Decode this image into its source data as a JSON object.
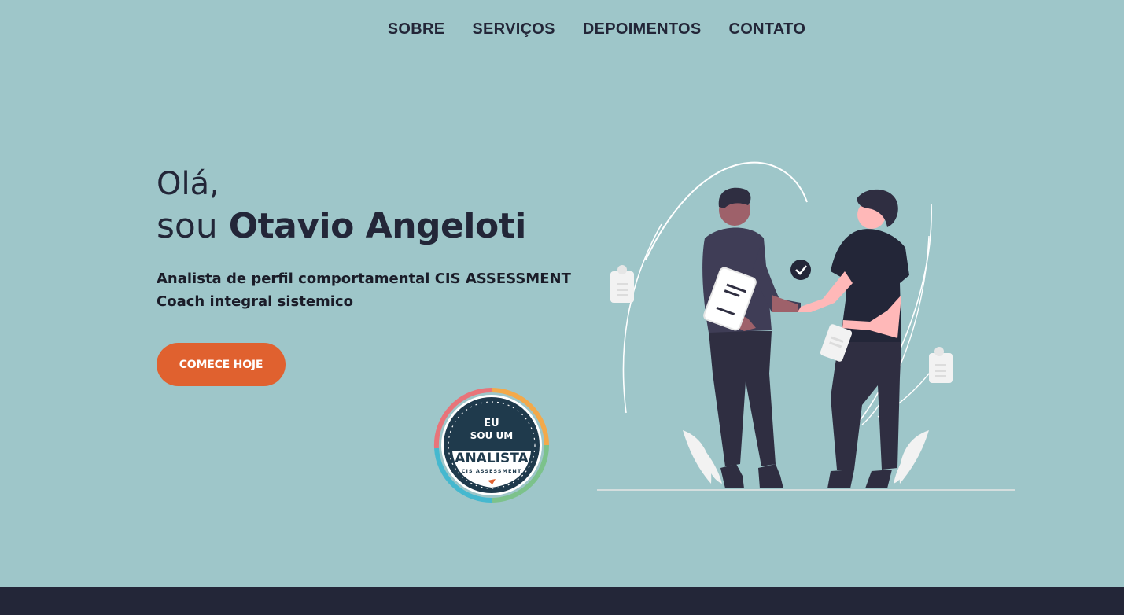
{
  "nav": {
    "items": [
      {
        "label": "SOBRE"
      },
      {
        "label": "SERVIÇOS"
      },
      {
        "label": "DEPOIMENTOS"
      },
      {
        "label": "CONTATO"
      }
    ]
  },
  "hero": {
    "greeting": "Olá,",
    "name_prefix": "sou",
    "name": "Otavio Angeloti",
    "tagline_line1": "Analista de perfil comportamental CIS ASSESSMENT",
    "tagline_line2": "Coach integral sistemico",
    "cta_label": "COMECE HOJE"
  },
  "badge": {
    "line1": "EU",
    "line2": "SOU UM",
    "line3": "ANALISTA",
    "line4": "CIS ASSESSMENT"
  },
  "colors": {
    "background": "#9ec6c9",
    "text": "#232638",
    "accent": "#e0612f",
    "footer": "#232638",
    "badge_dark": "#1f3a4c"
  },
  "icons": {
    "check": "check-circle-icon",
    "document": "document-icon",
    "clipboard": "clipboard-icon"
  }
}
